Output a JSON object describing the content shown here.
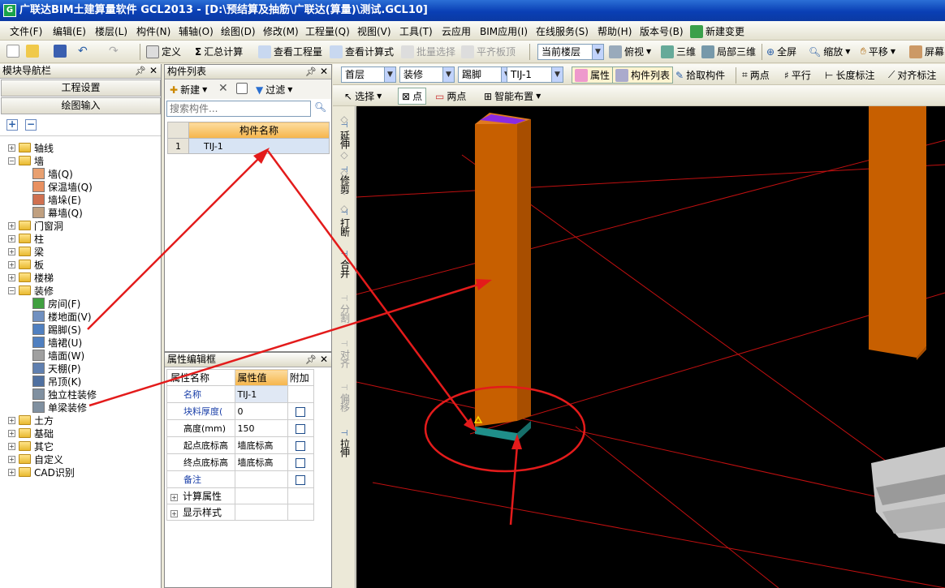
{
  "window": {
    "title": "广联达BIM土建算量软件 GCL2013 - [D:\\预结算及抽筋\\广联达(算量)\\测试.GCL10]"
  },
  "menu": [
    "文件(F)",
    "编辑(E)",
    "楼层(L)",
    "构件(N)",
    "辅轴(O)",
    "绘图(D)",
    "修改(M)",
    "工程量(Q)",
    "视图(V)",
    "工具(T)",
    "云应用",
    "BIM应用(I)",
    "在线服务(S)",
    "帮助(H)",
    "版本号(B)",
    "新建变更"
  ],
  "toolbar1": {
    "define": "定义",
    "sum": "汇总计算",
    "view_qty": "查看工程量",
    "view_formula": "查看计算式",
    "batch_select": "批量选择",
    "align_slab": "平齐板顶",
    "current_floor": "当前楼层",
    "view_mode": "俯视",
    "three_d": "三维",
    "local_3d": "局部三维",
    "fullscreen": "全屏",
    "zoom": "缩放",
    "pan": "平移",
    "screen_rotate": "屏幕"
  },
  "toolbar2": {
    "floor": "首层",
    "category": "装修",
    "type": "踢脚",
    "component": "TIJ-1",
    "properties": "属性",
    "comp_list": "构件列表",
    "pick": "拾取构件",
    "two_point": "两点",
    "parallel": "平行",
    "length_dim": "长度标注",
    "align_dim": "对齐标注"
  },
  "toolbar3": {
    "select": "选择",
    "point": "点",
    "two_point": "两点",
    "smart_place": "智能布置"
  },
  "nav": {
    "title": "模块导航栏",
    "btn_project": "工程设置",
    "btn_draw": "绘图输入",
    "tree": [
      {
        "label": "轴线",
        "level": 0,
        "exp": "+"
      },
      {
        "label": "墙",
        "level": 0,
        "exp": "-"
      },
      {
        "label": "墙(Q)",
        "level": 1
      },
      {
        "label": "保温墙(Q)",
        "level": 1
      },
      {
        "label": "墙垛(E)",
        "level": 1
      },
      {
        "label": "幕墙(Q)",
        "level": 1
      },
      {
        "label": "门窗洞",
        "level": 0,
        "exp": "+"
      },
      {
        "label": "柱",
        "level": 0,
        "exp": "+"
      },
      {
        "label": "梁",
        "level": 0,
        "exp": "+"
      },
      {
        "label": "板",
        "level": 0,
        "exp": "+"
      },
      {
        "label": "楼梯",
        "level": 0,
        "exp": "+"
      },
      {
        "label": "装修",
        "level": 0,
        "exp": "-"
      },
      {
        "label": "房间(F)",
        "level": 1
      },
      {
        "label": "楼地面(V)",
        "level": 1
      },
      {
        "label": "踢脚(S)",
        "level": 1
      },
      {
        "label": "墙裙(U)",
        "level": 1
      },
      {
        "label": "墙面(W)",
        "level": 1
      },
      {
        "label": "天棚(P)",
        "level": 1
      },
      {
        "label": "吊顶(K)",
        "level": 1
      },
      {
        "label": "独立柱装修",
        "level": 1
      },
      {
        "label": "单梁装修",
        "level": 1
      },
      {
        "label": "土方",
        "level": 0,
        "exp": "+"
      },
      {
        "label": "基础",
        "level": 0,
        "exp": "+"
      },
      {
        "label": "其它",
        "level": 0,
        "exp": "+"
      },
      {
        "label": "自定义",
        "level": 0,
        "exp": "+"
      },
      {
        "label": "CAD识别",
        "level": 0,
        "exp": "+"
      }
    ]
  },
  "comp_list": {
    "title": "构件列表",
    "new": "新建",
    "filter": "过滤",
    "search_placeholder": "搜索构件...",
    "col_header": "构件名称",
    "rows": [
      {
        "num": "1",
        "name": "TIJ-1"
      }
    ]
  },
  "props": {
    "title": "属性编辑框",
    "headers": [
      "属性名称",
      "属性值",
      "附加"
    ],
    "rows": [
      {
        "name": "名称",
        "value": "TIJ-1",
        "check": false,
        "blue": true
      },
      {
        "name": "块料厚度(",
        "value": "0",
        "check": true,
        "blue": true
      },
      {
        "name": "高度(mm)",
        "value": "150",
        "check": true,
        "blue": false
      },
      {
        "name": "起点底标高",
        "value": "墙底标高",
        "check": true,
        "blue": false
      },
      {
        "name": "终点底标高",
        "value": "墙底标高",
        "check": true,
        "blue": false
      },
      {
        "name": "备注",
        "value": "",
        "check": true,
        "blue": true
      }
    ],
    "groups": [
      "计算属性",
      "显示样式"
    ]
  },
  "vtool": [
    "延伸",
    "修剪",
    "打断",
    "合并",
    "分割",
    "对齐",
    "偏移",
    "拉伸"
  ],
  "colors": {
    "column": "#c75f00",
    "baseboard": "#1f8f8a",
    "annotation": "#e31b1b",
    "grid": "#c01010",
    "top_face": "#8a2be2"
  }
}
